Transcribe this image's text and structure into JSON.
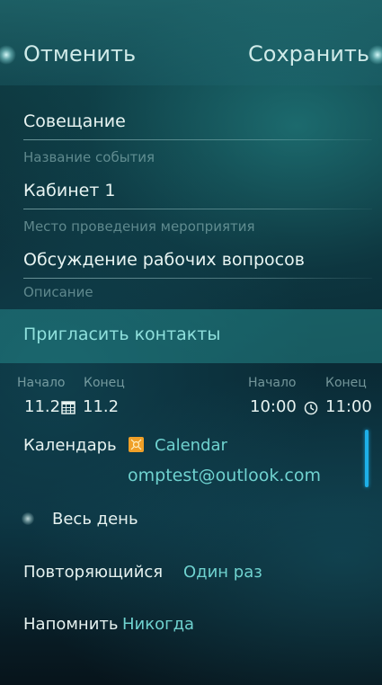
{
  "header": {
    "cancel_label": "Отменить",
    "save_label": "Сохранить"
  },
  "form": {
    "title_value": "Совещание",
    "title_label": "Название события",
    "location_value": "Кабинет 1",
    "location_label": "Место проведения мероприятия",
    "description_value": "Обсуждение рабочих вопросов",
    "description_label": "Описание"
  },
  "invite": {
    "label": "Пригласить контакты"
  },
  "date": {
    "start_label": "Начало",
    "end_label": "Конец",
    "start_value": "11.2",
    "end_value": "11.2",
    "icon": "calendar-icon"
  },
  "time": {
    "start_label": "Начало",
    "end_label": "Конец",
    "start_value": "10:00",
    "end_value": "11:00",
    "icon": "clock-icon"
  },
  "calendar": {
    "label": "Календарь",
    "name": "Calendar",
    "account": "omptest@outlook.com",
    "badge_color": "#f0a028"
  },
  "all_day": {
    "label": "Весь день",
    "checked": false
  },
  "recurrence": {
    "label": "Повторяющийся",
    "value": "Один раз"
  },
  "reminder": {
    "label": "Напомнить",
    "value": "Никогда"
  },
  "colors": {
    "accent": "#6fd2cf",
    "scrollbar": "#1eb0e8"
  }
}
